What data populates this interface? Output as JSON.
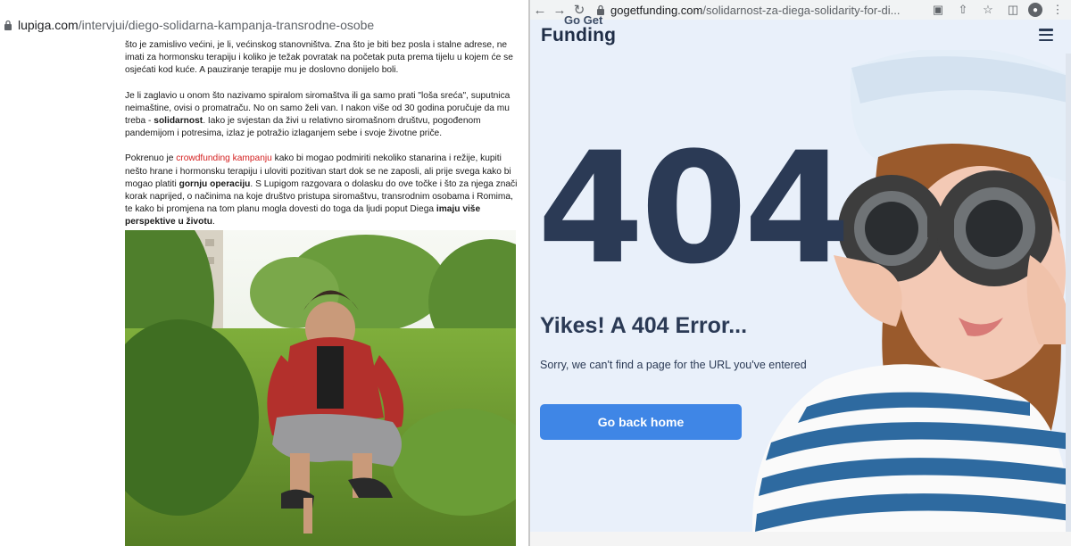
{
  "left_window": {
    "url_host": "lupiga.com",
    "url_path": "/intervjui/diego-solidarna-kampanja-transrodne-osobe",
    "article": {
      "p1": "što je zamislivo većini, je li, većinskog stanovništva. Zna što je biti bez posla i stalne adrese, ne imati za hormonsku terapiju i koliko je težak povratak na početak puta prema tijelu u kojem će se osjećati kod kuće. A pauziranje terapije mu je doslovno donijelo boli.",
      "p2a": "Je li zaglavio u onom što nazivamo spiralom siromaštva ili ga samo prati \"loša sreća\", suputnica neimaštine, ovisi o promatraču. No on samo želi van. I nakon više od 30 godina poručuje da mu treba - ",
      "p2b": "solidarnost",
      "p2c": ". Iako je svjestan da živi u relativno siromašnom društvu, pogođenom pandemijom i potresima, izlaz je potražio izlaganjem sebe i svoje životne priče.",
      "p3a": "Pokrenuo je ",
      "p3link": "crowdfunding kampanju",
      "p3b": " kako bi mogao podmiriti nekoliko stanarina i režije, kupiti nešto hrane i hormonsku terapiju i uloviti pozitivan start dok se ne zaposli, ali prije svega kako bi mogao platiti ",
      "p3c": "gornju operaciju",
      "p3d": ". S Lupigom razgovara o dolasku do ove točke i što za njega znači korak naprijed, o načinima na koje društvo pristupa siromaštvu, transrodnim osobama i Romima, te kako bi promjena na tom planu mogla dovesti do toga da ljudi poput Diega ",
      "p3e": "imaju više perspektive u životu",
      "p3f": "."
    }
  },
  "right_window": {
    "url_host": "gogetfunding.com",
    "url_path": "/solidarnost-za-diega-solidarity-for-di...",
    "logo_line1": "Go Get",
    "logo_line2": "Funding",
    "big_code": "404",
    "title": "Yikes! A 404 Error...",
    "subtitle": "Sorry, we can't find a page for the URL you've entered",
    "button_label": "Go back home"
  },
  "colors": {
    "accent_blue": "#3f86e6",
    "navy": "#2b3a55",
    "link_red": "#d41f1f",
    "page_bg": "#e9f0fa"
  }
}
